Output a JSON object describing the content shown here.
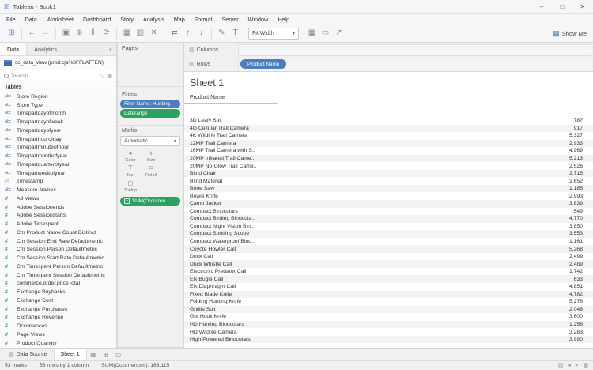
{
  "colors": {
    "pill_blue": "#4a7ebd",
    "pill_green": "#2aa360",
    "dim_icon": "#4e79a7",
    "measure_icon": "#4fa35f",
    "band": "#f2f3f4"
  },
  "titlebar": {
    "title": "Tableau - Book1",
    "minimize": "–",
    "maximize": "□",
    "close": "✕"
  },
  "menu": {
    "items": [
      "File",
      "Data",
      "Worksheet",
      "Dashboard",
      "Story",
      "Analysis",
      "Map",
      "Format",
      "Server",
      "Window",
      "Help"
    ]
  },
  "toolbar": {
    "groups": [
      [
        {
          "name": "tableau-logo-icon",
          "glyph": "⊞"
        }
      ],
      [
        {
          "name": "back-icon",
          "glyph": "←"
        },
        {
          "name": "forward-icon",
          "glyph": "→"
        }
      ],
      [
        {
          "name": "save-icon",
          "glyph": "▣"
        },
        {
          "name": "add-data-icon",
          "glyph": "⊕"
        },
        {
          "name": "pause-updates-icon",
          "glyph": "‖"
        },
        {
          "name": "run-updates-icon",
          "glyph": "⟳"
        }
      ],
      [
        {
          "name": "new-worksheet-icon",
          "glyph": "▦"
        },
        {
          "name": "duplicate-icon",
          "glyph": "▥"
        },
        {
          "name": "clear-sheet-icon",
          "glyph": "✕"
        }
      ],
      [
        {
          "name": "swap-axes-icon",
          "glyph": "⇄"
        },
        {
          "name": "sort-ascending-icon",
          "glyph": "↑"
        },
        {
          "name": "sort-descending-icon",
          "glyph": "↓"
        }
      ],
      [
        {
          "name": "highlight-icon",
          "glyph": "✎"
        },
        {
          "name": "show-labels-icon",
          "glyph": "T"
        }
      ]
    ],
    "fit": {
      "label": "Fit Width",
      "chevron": "▾"
    },
    "right_icons": [
      {
        "name": "show-hide-cards-icon",
        "glyph": "▦"
      },
      {
        "name": "presentation-mode-icon",
        "glyph": "▭"
      },
      {
        "name": "share-icon",
        "glyph": "↗"
      }
    ],
    "show_me": {
      "label": "Show Me"
    }
  },
  "data_pane": {
    "tabs": [
      {
        "label": "Data"
      },
      {
        "label": "Analytics"
      }
    ],
    "collapse_glyph": "‹",
    "datasource": {
      "label": "cc_data_view (prod:cja%3FFLATTEN)"
    },
    "search": {
      "placeholder": "Search"
    },
    "tables_label": "Tables",
    "fields": [
      {
        "label": "Store Region",
        "icon": "abc"
      },
      {
        "label": "Store Type",
        "icon": "abc"
      },
      {
        "label": "Timepartdayofmonth",
        "icon": "abc"
      },
      {
        "label": "Timepartdayofweek",
        "icon": "abc"
      },
      {
        "label": "Timepartdayofyear",
        "icon": "abc"
      },
      {
        "label": "Timeparthourofday",
        "icon": "abc"
      },
      {
        "label": "Timepartminuteofhour",
        "icon": "abc"
      },
      {
        "label": "Timepartmonthofyear",
        "icon": "abc"
      },
      {
        "label": "Timepartquarterofyear",
        "icon": "abc"
      },
      {
        "label": "Timepartweekofyear",
        "icon": "abc"
      },
      {
        "label": "Timestamp",
        "icon": "datetime"
      },
      {
        "label": "Measure Names",
        "icon": "abc",
        "italic": true,
        "divider": true
      },
      {
        "label": "Ad Views",
        "icon": "hash"
      },
      {
        "label": "Adobe Sessionends",
        "icon": "hash"
      },
      {
        "label": "Adobe Sessionstarts",
        "icon": "hash"
      },
      {
        "label": "Adobe Timespent",
        "icon": "hash"
      },
      {
        "label": "Cm Product Name Count Distinct",
        "icon": "hash"
      },
      {
        "label": "Cm Session End Rate Defaultmetric",
        "icon": "hash"
      },
      {
        "label": "Cm Session Person Defaultmetric",
        "icon": "hash"
      },
      {
        "label": "Cm Session Start Rate Defaultmetric",
        "icon": "hash"
      },
      {
        "label": "Cm Timespent Person Defaultmetric",
        "icon": "hash"
      },
      {
        "label": "Cm Timespent Session Defaultmetric",
        "icon": "hash"
      },
      {
        "label": "commerce.order.priceTotal",
        "icon": "hash"
      },
      {
        "label": "Exchange Buybacks",
        "icon": "hash"
      },
      {
        "label": "Exchange Cost",
        "icon": "hash"
      },
      {
        "label": "Exchange Purchases",
        "icon": "hash"
      },
      {
        "label": "Exchange Revenue",
        "icon": "hash"
      },
      {
        "label": "Occurrences",
        "icon": "hash"
      },
      {
        "label": "Page Views",
        "icon": "hash"
      },
      {
        "label": "Product Quantity",
        "icon": "hash"
      }
    ]
  },
  "cards": {
    "pages": {
      "label": "Pages"
    },
    "filters": {
      "label": "Filters",
      "pills": [
        {
          "label": "Filter Name: Hunting..",
          "color": "blue"
        },
        {
          "label": "Daterange",
          "color": "green"
        }
      ]
    },
    "marks": {
      "label": "Marks",
      "type_dropdown": {
        "value": "Automatic",
        "chevron": "▾"
      },
      "buttons": [
        {
          "label": "Color",
          "glyph": "●",
          "name": "color-button"
        },
        {
          "label": "Size",
          "glyph": "↕",
          "name": "size-button"
        },
        {
          "label": "Text",
          "glyph": "T",
          "name": "text-button"
        },
        {
          "label": "Detail",
          "glyph": "≡",
          "name": "detail-button"
        },
        {
          "label": "Tooltip",
          "glyph": "◻",
          "name": "tooltip-button"
        }
      ],
      "pills": [
        {
          "label": "SUM(Occurren..",
          "color": "green",
          "icon": "T"
        }
      ]
    }
  },
  "shelves": {
    "columns": {
      "label": "Columns",
      "pills": []
    },
    "rows": {
      "label": "Rows",
      "pills": [
        {
          "label": "Product Name",
          "color": "blue"
        }
      ]
    }
  },
  "sheet": {
    "title": "Sheet 1",
    "header": "Product Name",
    "rows": [
      {
        "label": "3D Leafy Suit",
        "value": "787"
      },
      {
        "label": "4G Cellular Trail Camera",
        "value": "917"
      },
      {
        "label": "4K Wildlife Trail Camera",
        "value": "5.327"
      },
      {
        "label": "12MP Trail Camera",
        "value": "2.933"
      },
      {
        "label": "16MP Trail Camera with S..",
        "value": "4.969"
      },
      {
        "label": "20MP Infrared Trail Came..",
        "value": "5.213"
      },
      {
        "label": "20MP No-Glow Trail Came..",
        "value": "2.526"
      },
      {
        "label": "Blind Chair",
        "value": "2.715"
      },
      {
        "label": "Blind Material",
        "value": "2.652"
      },
      {
        "label": "Bone Saw",
        "value": "1.185"
      },
      {
        "label": "Bowie Knife",
        "value": "2.993"
      },
      {
        "label": "Camo Jacket",
        "value": "3.839"
      },
      {
        "label": "Compact Binoculars",
        "value": "549"
      },
      {
        "label": "Compact Birding Binocula..",
        "value": "4.770"
      },
      {
        "label": "Compact Night Vision Bin..",
        "value": "3.850"
      },
      {
        "label": "Compact Spotting Scope",
        "value": "3.553"
      },
      {
        "label": "Compact Waterproof Bino..",
        "value": "1.161"
      },
      {
        "label": "Coyote Howler Call",
        "value": "5.268"
      },
      {
        "label": "Duck Call",
        "value": "2.499"
      },
      {
        "label": "Duck Whistle Call",
        "value": "2.489"
      },
      {
        "label": "Electronic Predator Call",
        "value": "1.742"
      },
      {
        "label": "Elk Bugle Call",
        "value": "633"
      },
      {
        "label": "Elk Diaphragm Call",
        "value": "4.851"
      },
      {
        "label": "Fixed Blade Knife",
        "value": "4.782"
      },
      {
        "label": "Folding Hunting Knife",
        "value": "5.276"
      },
      {
        "label": "Ghillie Suit",
        "value": "2.046"
      },
      {
        "label": "Gut Hook Knife",
        "value": "3.600"
      },
      {
        "label": "HD Hunting Binoculars",
        "value": "1.256"
      },
      {
        "label": "HD Wildlife Camera",
        "value": "3.283"
      },
      {
        "label": "High-Powered Binoculars",
        "value": "3.990"
      }
    ]
  },
  "bottom_tabs": {
    "tabs": [
      {
        "label": "Data Source",
        "icon_glyph": "▤",
        "active": false
      },
      {
        "label": "Sheet 1",
        "active": true
      }
    ],
    "new_icons": [
      {
        "name": "new-worksheet-button",
        "glyph": "▦"
      },
      {
        "name": "new-dashboard-button",
        "glyph": "⊞"
      },
      {
        "name": "new-story-button",
        "glyph": "▭"
      }
    ]
  },
  "status_bar": {
    "marks": "53 marks",
    "dims": "53 rows by 1 column",
    "agg": "SUM(Occurrences): 163.115",
    "nav_icons": [
      {
        "name": "show-filmstrip-icon",
        "glyph": "▤"
      },
      {
        "name": "previous-sheet-icon",
        "glyph": "◂"
      },
      {
        "name": "next-sheet-icon",
        "glyph": "▸"
      },
      {
        "name": "show-sheet-sorter-icon",
        "glyph": "▦"
      }
    ]
  }
}
